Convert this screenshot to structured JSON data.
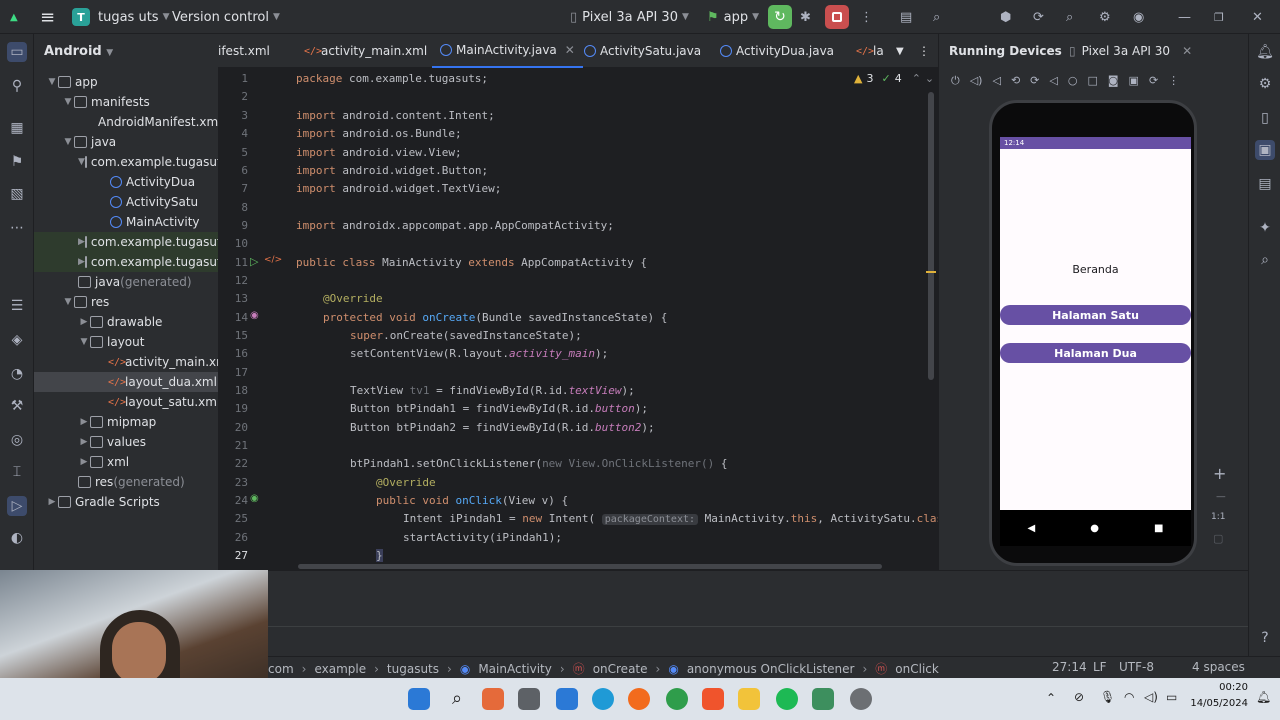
{
  "titlebar": {
    "project_initial": "T",
    "project_name": "tugas uts",
    "vcs_label": "Version control",
    "device_label": "Pixel 3a API 30",
    "run_config": "app"
  },
  "project_panel": {
    "view_label": "Android",
    "items": [
      {
        "label": "app",
        "suffix": ""
      },
      {
        "label": "manifests",
        "suffix": ""
      },
      {
        "label": "AndroidManifest.xml",
        "suffix": ""
      },
      {
        "label": "java",
        "suffix": ""
      },
      {
        "label": "com.example.tugasut",
        "suffix": ""
      },
      {
        "label": "ActivityDua",
        "suffix": ""
      },
      {
        "label": "ActivitySatu",
        "suffix": ""
      },
      {
        "label": "MainActivity",
        "suffix": ""
      },
      {
        "label": "com.example.tugasut",
        "suffix": ""
      },
      {
        "label": "com.example.tugasut",
        "suffix": ""
      },
      {
        "label": "java",
        "suffix": " (generated)"
      },
      {
        "label": "res",
        "suffix": ""
      },
      {
        "label": "drawable",
        "suffix": ""
      },
      {
        "label": "layout",
        "suffix": ""
      },
      {
        "label": "activity_main.xml",
        "suffix": ""
      },
      {
        "label": "layout_dua.xml",
        "suffix": ""
      },
      {
        "label": "layout_satu.xml",
        "suffix": ""
      },
      {
        "label": "mipmap",
        "suffix": ""
      },
      {
        "label": "values",
        "suffix": ""
      },
      {
        "label": "xml",
        "suffix": ""
      },
      {
        "label": "res",
        "suffix": " (generated)"
      },
      {
        "label": "Gradle Scripts",
        "suffix": ""
      }
    ]
  },
  "tabs": [
    "ifest.xml",
    "activity_main.xml",
    "MainActivity.java",
    "ActivitySatu.java",
    "ActivityDua.java",
    "la"
  ],
  "editor": {
    "warnings": "3",
    "weak_warnings": "4",
    "line_numbers": [
      "1",
      "2",
      "3",
      "4",
      "5",
      "6",
      "7",
      "8",
      "9",
      "10",
      "11",
      "12",
      "13",
      "14",
      "15",
      "16",
      "17",
      "18",
      "19",
      "20",
      "21",
      "22",
      "23",
      "24",
      "25",
      "26",
      "27"
    ],
    "lines": {
      "l1a": "package",
      "l1b": " com.example.tugasuts;",
      "l3a": "import",
      "l3b": " android.content.Intent;",
      "l4a": "import",
      "l4b": " android.os.Bundle;",
      "l5a": "import",
      "l5b": " android.view.View;",
      "l6a": "import",
      "l6b": " android.widget.Button;",
      "l7a": "import",
      "l7b": " android.widget.TextView;",
      "l9a": "import",
      "l9b": " androidx.appcompat.app.AppCompatActivity;",
      "l11a": "public class",
      "l11b": " MainActivity ",
      "l11c": "extends",
      "l11d": " AppCompatActivity {",
      "l13": "@Override",
      "l14a": "protected void",
      "l14b": "onCreate",
      "l14c": "(Bundle savedInstanceState) {",
      "l15a": "super",
      "l15b": ".onCreate(savedInstanceState);",
      "l16a": "setContentView(R.layout.",
      "l16b": "activity_main",
      "l16c": ");",
      "l18a": "TextView ",
      "l18b": "tv1",
      "l18c": " = findViewById(R.id.",
      "l18d": "textView",
      "l18e": ");",
      "l19a": "Button btPindah1 = findViewById(R.id.",
      "l19b": "button",
      "l19c": ");",
      "l20a": "Button btPindah2 = findViewById(R.id.",
      "l20b": "button2",
      "l20c": ");",
      "l22a": "btPindah1.setOnClickListener(",
      "l22b": "new View.OnClickListener()",
      "l22c": " {",
      "l24": "@Override",
      "l25a": "public void",
      "l25b": "onClick",
      "l25c": "(View v) {",
      "l26a": "Intent ",
      "l26b": "iPindah1",
      "l26c": " = ",
      "l26d": "new",
      "l26e": " Intent(",
      "l26hint": "packageContext:",
      "l26f": " MainActivity.",
      "l26g": "this",
      "l26h": ", ActivitySatu.",
      "l26i": "class",
      "l27": "startActivity(iPindah1);",
      "l28": "}"
    }
  },
  "devices": {
    "title": "Running Devices",
    "tab_label": "Pixel 3a API 30",
    "phone": {
      "time": "12:14",
      "label": "Beranda",
      "button1": "Halaman Satu",
      "button2": "Halaman Dua",
      "nav_back": "◀",
      "nav_home": "●",
      "nav_recent": "■"
    },
    "zoom_ratio": "1:1"
  },
  "statusbar": {
    "breadcrumbs": [
      "com",
      "example",
      "tugasuts",
      "MainActivity",
      "onCreate",
      "anonymous OnClickListener",
      "onClick"
    ],
    "position": "27:14",
    "line_sep": "LF",
    "encoding": "UTF-8",
    "indent": "4 spaces"
  },
  "taskbar": {
    "time": "00:20",
    "date": "14/05/2024"
  },
  "colors": {
    "accent": "#3574f0",
    "phone_primary": "#6750a4",
    "run_green": "#5fb85f",
    "stop_red": "#c94f4f"
  }
}
